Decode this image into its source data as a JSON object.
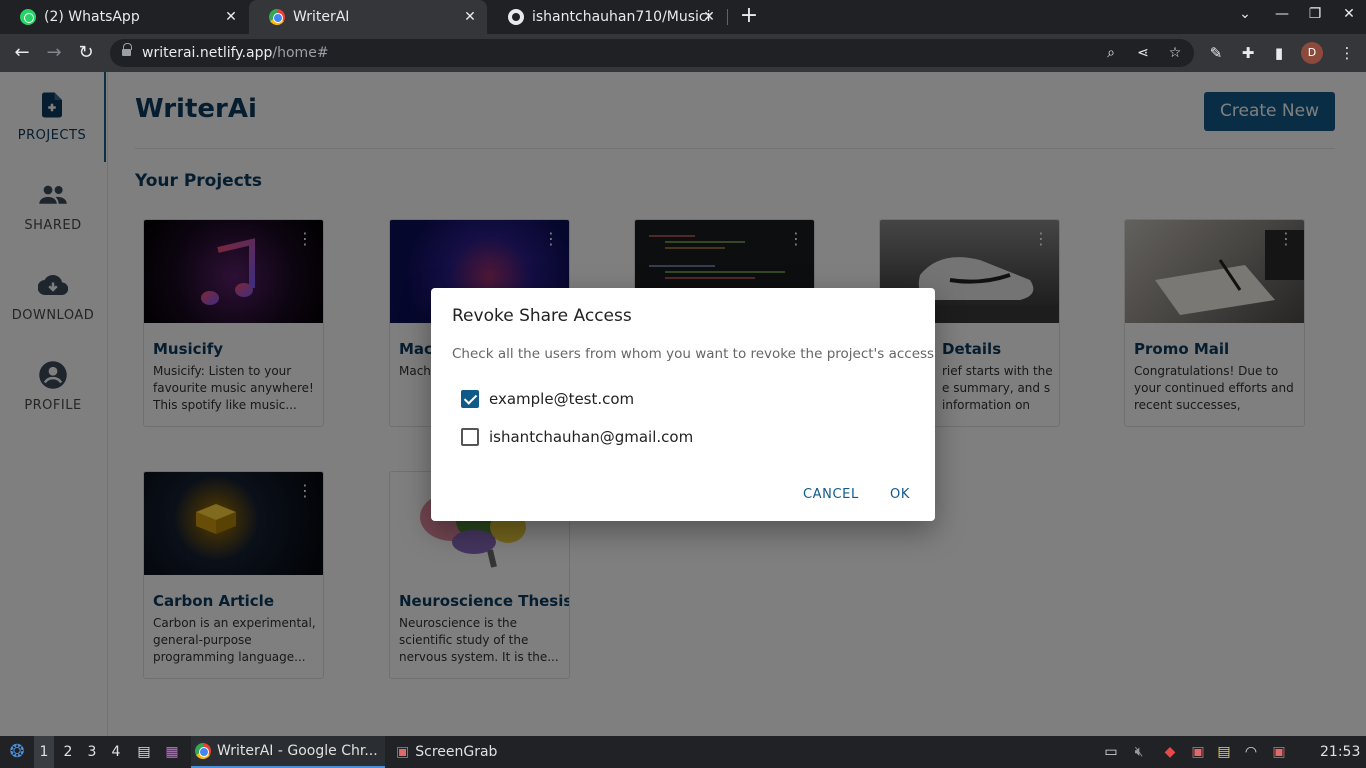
{
  "browser": {
    "tabs": [
      {
        "title": "(2) WhatsApp",
        "favicon": "whatsapp-icon"
      },
      {
        "title": "WriterAI",
        "favicon": "writerai-icon"
      },
      {
        "title": "ishantchauhan710/Musicify",
        "favicon": "github-icon"
      }
    ],
    "url_host": "writerai.netlify.app",
    "url_path": "/home#",
    "profile_initial": "D"
  },
  "sidebar": {
    "items": [
      {
        "label": "PROJECTS",
        "icon": "add-document-icon"
      },
      {
        "label": "SHARED",
        "icon": "group-icon"
      },
      {
        "label": "DOWNLOAD",
        "icon": "cloud-download-icon"
      },
      {
        "label": "PROFILE",
        "icon": "account-circle-icon"
      }
    ]
  },
  "header": {
    "title": "WriterAi",
    "create_label": "Create New"
  },
  "projects": {
    "title": "Your Projects",
    "cards": [
      {
        "title": "Musicify",
        "desc": "Musicify: Listen to your favourite music anywhere! This spotify like music..."
      },
      {
        "title": "Mac",
        "desc": "Mach type (AI) th"
      },
      {
        "title": "",
        "desc": ""
      },
      {
        "title": "Details",
        "desc": "rief starts with the e summary, and s information on th..."
      },
      {
        "title": "Promo Mail",
        "desc": "Congratulations! Due to your continued efforts and recent successes, effective..."
      },
      {
        "title": "Carbon Article",
        "desc": "Carbon is an experimental, general-purpose programming language..."
      },
      {
        "title": "Neuroscience Thesis",
        "desc": "Neuroscience is the scientific study of the nervous system. It is the..."
      }
    ]
  },
  "modal": {
    "title": "Revoke Share Access",
    "text": "Check all the users from whom you want to revoke the project's access",
    "users": [
      {
        "email": "example@test.com",
        "checked": true
      },
      {
        "email": "ishantchauhan@gmail.com",
        "checked": false
      }
    ],
    "cancel_label": "CANCEL",
    "ok_label": "OK"
  },
  "taskbar": {
    "workspaces": [
      "1",
      "2",
      "3",
      "4"
    ],
    "apps": [
      {
        "label": "WriterAI - Google Chr..."
      },
      {
        "label": "ScreenGrab"
      }
    ],
    "clock": "21:53"
  },
  "colors": {
    "brand": "#105a8a",
    "title": "#0b3a5e"
  }
}
